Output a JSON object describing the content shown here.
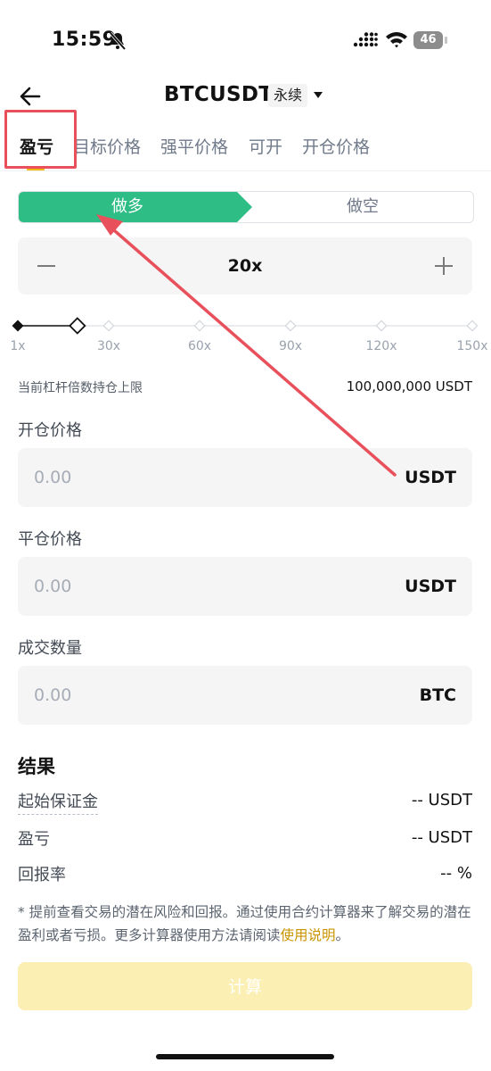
{
  "status_bar": {
    "time": "15:59",
    "battery": "46",
    "icons": [
      "bell-muted-icon",
      "signal-icon",
      "wifi-icon",
      "battery-icon"
    ]
  },
  "header": {
    "title": "BTCUSDT",
    "badge": "永续",
    "icons": [
      "back-arrow-icon",
      "caret-down-icon"
    ]
  },
  "tabs": [
    {
      "label": "盈亏",
      "active": true
    },
    {
      "label": "目标价格",
      "active": false
    },
    {
      "label": "强平价格",
      "active": false
    },
    {
      "label": "可开",
      "active": false
    },
    {
      "label": "开仓价格",
      "active": false
    }
  ],
  "side_toggle": {
    "long_label": "做多",
    "short_label": "做空",
    "selected": "long"
  },
  "leverage": {
    "value_label": "20x",
    "current": 20,
    "min": 1,
    "max": 150,
    "ticks": [
      "1x",
      "30x",
      "60x",
      "90x",
      "120x",
      "150x"
    ]
  },
  "position_limit": {
    "label": "当前杠杆倍数持仓上限",
    "value": "100,000,000 USDT"
  },
  "fields": [
    {
      "label": "开仓价格",
      "placeholder": "0.00",
      "value": "",
      "unit": "USDT"
    },
    {
      "label": "平仓价格",
      "placeholder": "0.00",
      "value": "",
      "unit": "USDT"
    },
    {
      "label": "成交数量",
      "placeholder": "0.00",
      "value": "",
      "unit": "BTC"
    }
  ],
  "results": {
    "title": "结果",
    "rows": [
      {
        "label": "起始保证金",
        "value": "-- USDT"
      },
      {
        "label": "盈亏",
        "value": "-- USDT"
      },
      {
        "label": "回报率",
        "value": "-- %"
      }
    ]
  },
  "note": {
    "text": "* 提前查看交易的潜在风险和回报。通过使用合约计算器来了解交易的潜在盈利或者亏损。更多计算器使用方法请阅读",
    "link": "使用说明",
    "suffix": "。"
  },
  "calculate_button": "计算",
  "colors": {
    "long_green": "#2ebd85",
    "accent_yellow": "#f0b90b",
    "annotation_red": "#e8505b",
    "button_disabled": "#fcefb4"
  }
}
